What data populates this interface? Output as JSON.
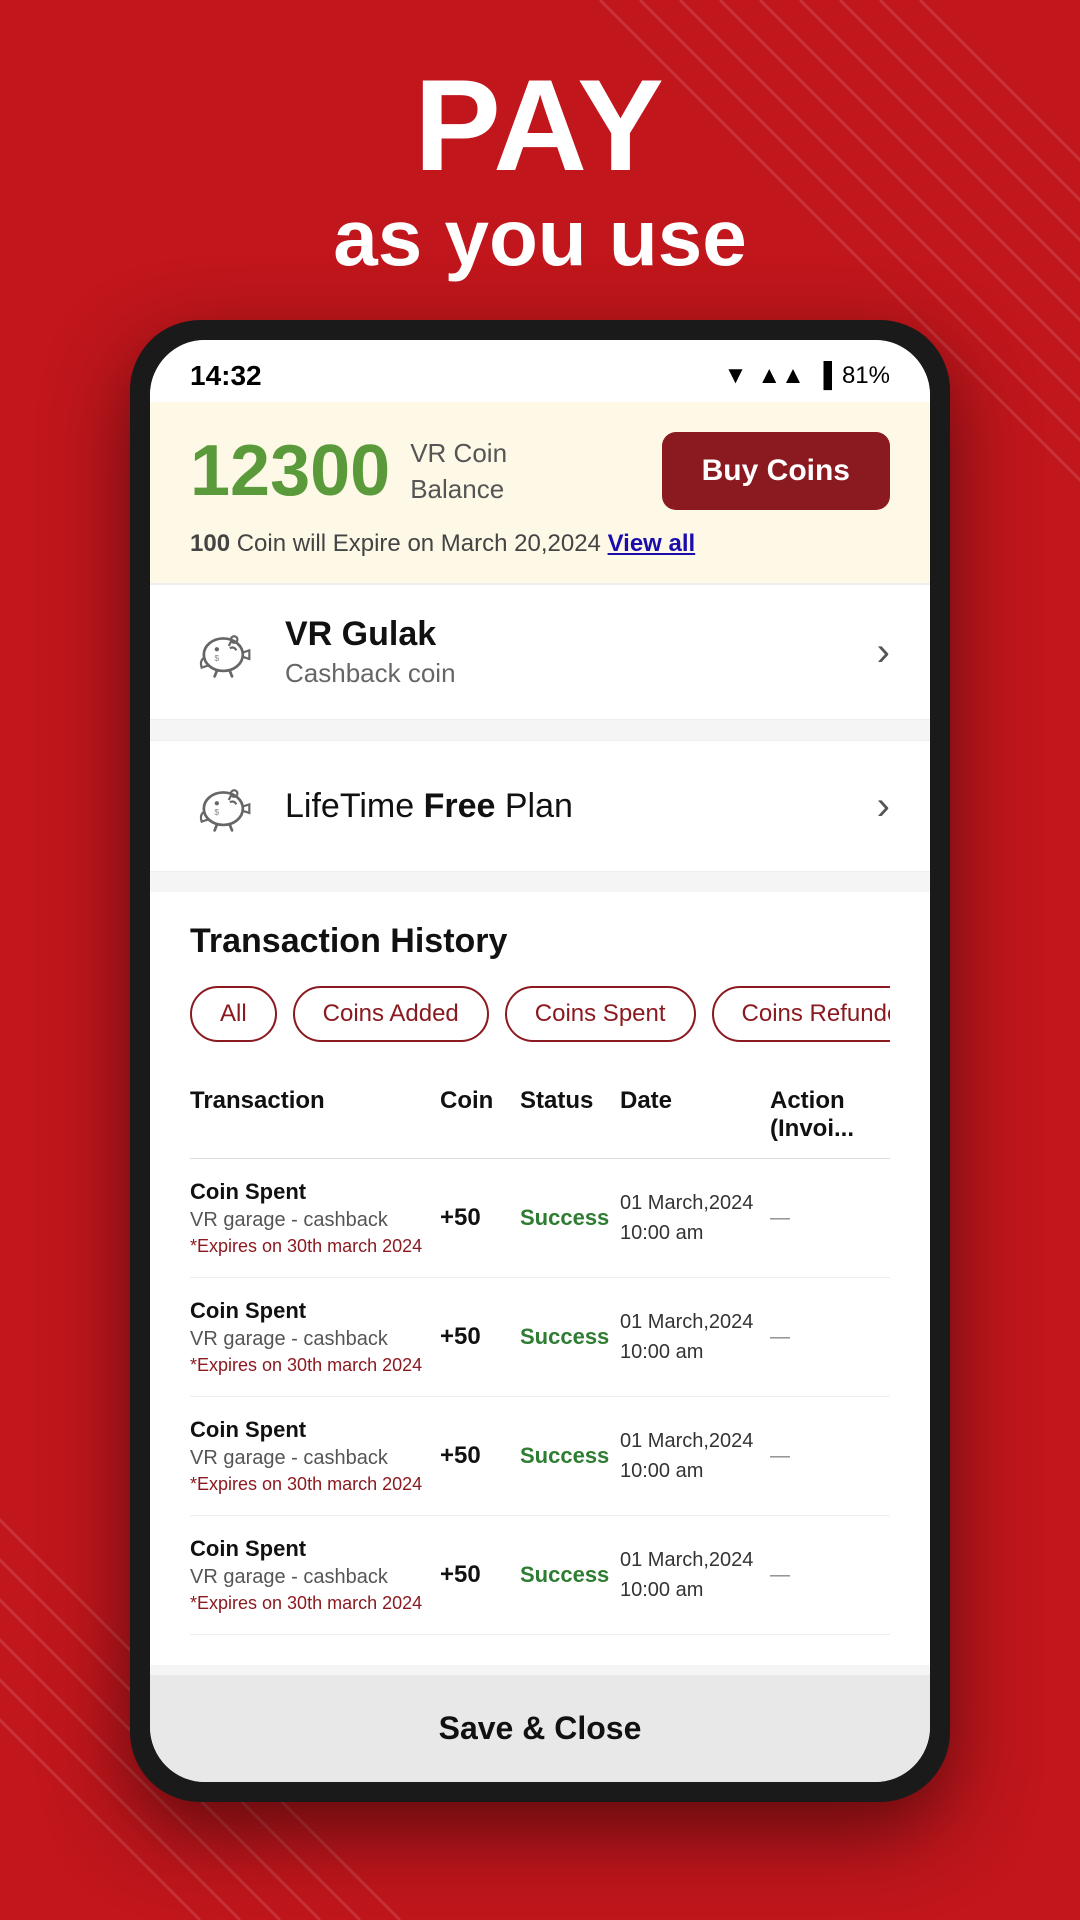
{
  "background_color": "#c0161c",
  "header": {
    "pay_text": "PAY",
    "sub_text": "as you use"
  },
  "status_bar": {
    "time": "14:32",
    "battery": "81%"
  },
  "balance": {
    "amount": "12300",
    "label_line1": "VR Coin",
    "label_line2": "Balance",
    "buy_button": "Buy Coins",
    "expiry_coin": "100",
    "expiry_text": "Coin will Expire on March 20,2024",
    "view_all": "View all"
  },
  "gulak_card": {
    "title": "VR Gulak",
    "subtitle": "Cashback coin"
  },
  "lifetime_card": {
    "title_normal": "LifeTime ",
    "title_bold": "Free",
    "title_end": " Plan"
  },
  "transaction": {
    "title": "Transaction History",
    "filters": [
      "All",
      "Coins Added",
      "Coins Spent",
      "Coins Refunde..."
    ],
    "table_headers": [
      "Transaction",
      "Coin",
      "Status",
      "Date",
      "Action\n(Invoi..."
    ],
    "rows": [
      {
        "name": "Coin Spent",
        "sub": "VR garage - cashback",
        "expires": "*Expires on 30th march 2024",
        "coin": "+50",
        "status": "Success",
        "date_line1": "01 March,2024",
        "date_line2": "10:00 am"
      },
      {
        "name": "Coin Spent",
        "sub": "VR garage - cashback",
        "expires": "*Expires on 30th march 2024",
        "coin": "+50",
        "status": "Success",
        "date_line1": "01 March,2024",
        "date_line2": "10:00 am"
      },
      {
        "name": "Coin Spent",
        "sub": "VR garage - cashback",
        "expires": "*Expires on 30th march 2024",
        "coin": "+50",
        "status": "Success",
        "date_line1": "01 March,2024",
        "date_line2": "10:00 am"
      },
      {
        "name": "Coin Spent",
        "sub": "VR garage - cashback",
        "expires": "*Expires on 30th march 2024",
        "coin": "+50",
        "status": "Success",
        "date_line1": "01 March,2024",
        "date_line2": "10:00 am"
      }
    ]
  },
  "save_close_button": "Save & Close"
}
